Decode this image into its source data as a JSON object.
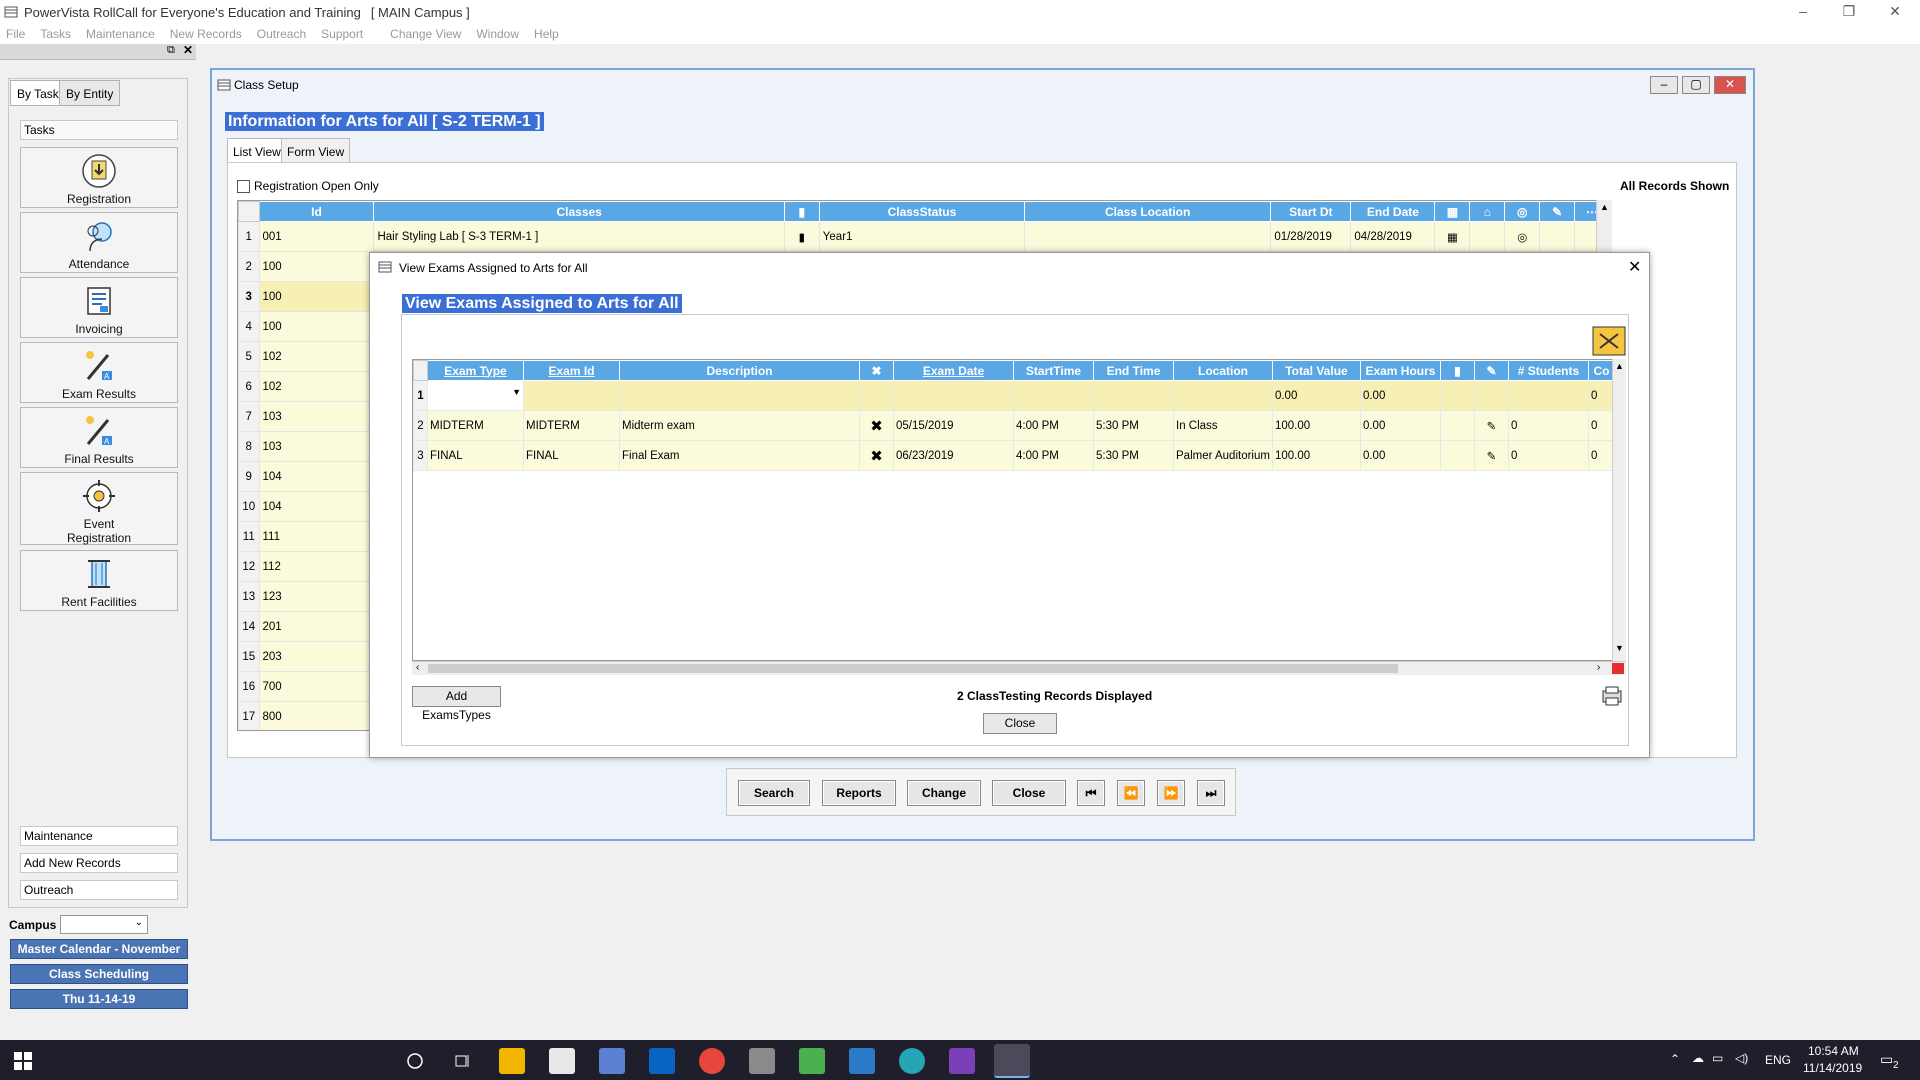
{
  "app": {
    "title": "PowerVista RollCall for Everyone's Education and Training",
    "campus_tag": "[ MAIN Campus ]"
  },
  "menu": [
    "File",
    "Tasks",
    "Maintenance",
    "New Records",
    "Outreach",
    "Support",
    "Change View",
    "Window",
    "Help"
  ],
  "left_panel": {
    "tabs": [
      "By Task",
      "By Entity"
    ],
    "tasks_header": "Tasks",
    "tasks": [
      {
        "label": "Registration",
        "icon": "registration-icon"
      },
      {
        "label": "Attendance",
        "icon": "attendance-icon"
      },
      {
        "label": "Invoicing",
        "icon": "invoicing-icon"
      },
      {
        "label": "Exam Results",
        "icon": "exam-results-icon"
      },
      {
        "label": "Final Results",
        "icon": "final-results-icon"
      },
      {
        "label": "Event\nRegistration",
        "icon": "event-registration-icon"
      },
      {
        "label": "Rent Facilities",
        "icon": "rent-facilities-icon"
      }
    ],
    "sections": [
      "Maintenance",
      "Add New Records",
      "Outreach"
    ],
    "campus_label": "Campus",
    "campus_value": "",
    "buttons": [
      "Master Calendar - November",
      "Class Scheduling",
      "Thu 11-14-19"
    ]
  },
  "class_setup": {
    "window_title": "Class Setup",
    "heading": "Information for Arts for All [ S-2 TERM-1 ]",
    "view_tabs": [
      "List View",
      "Form View"
    ],
    "registration_open_label": "Registration Open Only",
    "all_records_label": "All Records Shown",
    "columns": [
      "Id",
      "Classes",
      "ClassStatus",
      "Class Location",
      "Start Dt",
      "End Date"
    ],
    "rows": [
      {
        "n": "1",
        "id": "001",
        "class": "Hair Styling Lab [ S-3 TERM-1 ]",
        "status": "Year1",
        "location": "",
        "start": "01/28/2019",
        "end": "04/28/2019"
      },
      {
        "n": "2",
        "id": "100"
      },
      {
        "n": "3",
        "id": "100"
      },
      {
        "n": "4",
        "id": "100"
      },
      {
        "n": "5",
        "id": "102"
      },
      {
        "n": "6",
        "id": "102"
      },
      {
        "n": "7",
        "id": "103"
      },
      {
        "n": "8",
        "id": "103"
      },
      {
        "n": "9",
        "id": "104"
      },
      {
        "n": "10",
        "id": "104"
      },
      {
        "n": "11",
        "id": "111"
      },
      {
        "n": "12",
        "id": "112"
      },
      {
        "n": "13",
        "id": "123"
      },
      {
        "n": "14",
        "id": "201"
      },
      {
        "n": "15",
        "id": "203"
      },
      {
        "n": "16",
        "id": "700"
      },
      {
        "n": "17",
        "id": "800"
      }
    ],
    "nav_buttons": {
      "search": "Search",
      "reports": "Reports",
      "change": "Change",
      "close": "Close"
    }
  },
  "exams_dialog": {
    "window_title": "View Exams Assigned to Arts for All",
    "heading": "View Exams Assigned to Arts for All",
    "columns": [
      "Exam Type",
      "Exam Id",
      "Description",
      "",
      "Exam Date",
      "StartTime",
      "End Time",
      "Location",
      "Total Value",
      "Exam Hours",
      "",
      "",
      "# Students",
      "Co"
    ],
    "rows": [
      {
        "n": "1",
        "type": "",
        "id": "",
        "desc": "",
        "date": "",
        "start": "",
        "end": "",
        "loc": "",
        "total": "0.00",
        "hours": "0.00",
        "students": "",
        "co": "0"
      },
      {
        "n": "2",
        "type": "MIDTERM",
        "id": "MIDTERM",
        "desc": "Midterm exam",
        "date": "05/15/2019",
        "start": "4:00 PM",
        "end": "5:30 PM",
        "loc": "In Class",
        "total": "100.00",
        "hours": "0.00",
        "students": "0",
        "co": "0"
      },
      {
        "n": "3",
        "type": "FINAL",
        "id": "FINAL",
        "desc": "Final Exam",
        "date": "06/23/2019",
        "start": "4:00 PM",
        "end": "5:30 PM",
        "loc": "Palmer Auditorium",
        "total": "100.00",
        "hours": "0.00",
        "students": "0",
        "co": "0"
      }
    ],
    "add_button": "Add ExamsTypes",
    "status": "2 ClassTesting Records Displayed",
    "close_button": "Close"
  },
  "taskbar": {
    "lang": "ENG",
    "time": "10:54 AM",
    "date": "11/14/2019",
    "notif_count": "2"
  },
  "colors": {
    "header_blue": "#5aa7e6",
    "highlight": "#3b6fd6",
    "cream": "#fbfbdc",
    "taskbar": "#1f1f2b"
  }
}
